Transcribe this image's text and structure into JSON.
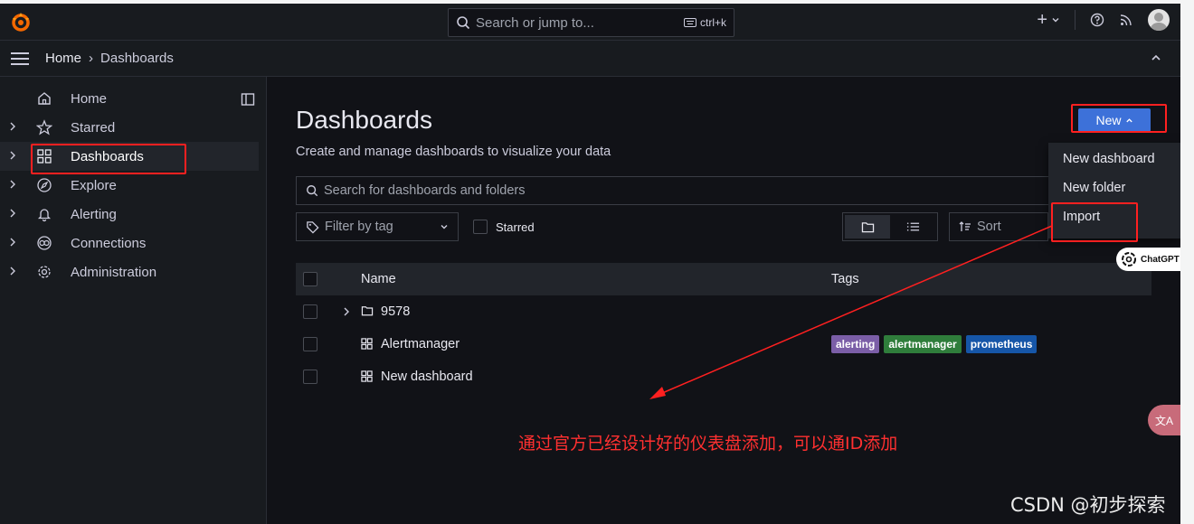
{
  "topbar": {
    "search_placeholder": "Search or jump to...",
    "search_shortcut": "ctrl+k",
    "plus_label": "+"
  },
  "breadcrumb": {
    "home": "Home",
    "separator": "›",
    "current": "Dashboards"
  },
  "sidebar": {
    "items": [
      {
        "label": "Home",
        "icon": "home-icon",
        "expandable": false
      },
      {
        "label": "Starred",
        "icon": "star-icon",
        "expandable": true
      },
      {
        "label": "Dashboards",
        "icon": "grid-icon",
        "expandable": true,
        "active": true
      },
      {
        "label": "Explore",
        "icon": "compass-icon",
        "expandable": true
      },
      {
        "label": "Alerting",
        "icon": "bell-icon",
        "expandable": true
      },
      {
        "label": "Connections",
        "icon": "connections-icon",
        "expandable": true
      },
      {
        "label": "Administration",
        "icon": "gear-icon",
        "expandable": true
      }
    ]
  },
  "main": {
    "title": "Dashboards",
    "subtitle": "Create and manage dashboards to visualize your data",
    "new_button": "New",
    "search_placeholder": "Search for dashboards and folders",
    "filter_placeholder": "Filter by tag",
    "starred_label": "Starred",
    "sort_label": "Sort",
    "columns": {
      "name": "Name",
      "tags": "Tags"
    },
    "rows": [
      {
        "name": "9578",
        "type": "folder",
        "tags": []
      },
      {
        "name": "Alertmanager",
        "type": "dashboard",
        "tags": [
          {
            "label": "alerting",
            "color": "#7b5ea7"
          },
          {
            "label": "alertmanager",
            "color": "#2f7d3b"
          },
          {
            "label": "prometheus",
            "color": "#1656a8"
          }
        ]
      },
      {
        "name": "New dashboard",
        "type": "dashboard",
        "tags": []
      }
    ]
  },
  "new_menu": {
    "items": [
      "New dashboard",
      "New folder",
      "Import"
    ]
  },
  "annotations": {
    "note": "通过官方已经设计好的仪表盘添加，可以通ID添加",
    "chatgpt_badge": "ChatGPT",
    "translate_badge": "文A",
    "watermark": "CSDN @初步探索"
  },
  "colors": {
    "accent": "#3d71d9",
    "annotation_red": "#ff2020",
    "logo_orange": "#f46800"
  }
}
